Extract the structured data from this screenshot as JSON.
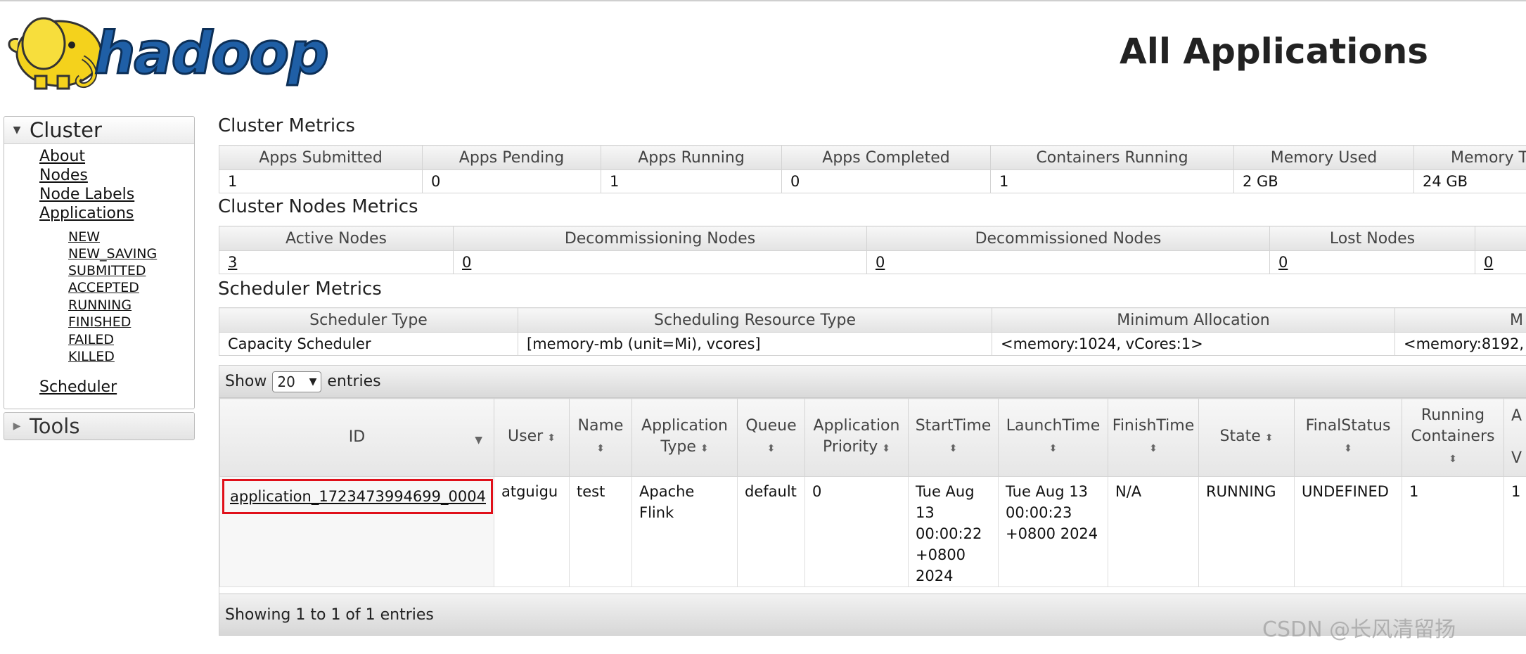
{
  "logo": {
    "text": "hadoop"
  },
  "page_title": "All Applications",
  "sidebar": {
    "cluster_title": "Cluster",
    "cluster_links": [
      "About",
      "Nodes",
      "Node Labels",
      "Applications"
    ],
    "app_states": [
      "NEW",
      "NEW_SAVING",
      "SUBMITTED",
      "ACCEPTED",
      "RUNNING",
      "FINISHED",
      "FAILED",
      "KILLED"
    ],
    "scheduler_link": "Scheduler",
    "tools_title": "Tools"
  },
  "cluster_metrics": {
    "title": "Cluster Metrics",
    "headers": [
      "Apps Submitted",
      "Apps Pending",
      "Apps Running",
      "Apps Completed",
      "Containers Running",
      "Memory Used",
      "Memory T"
    ],
    "values": [
      "1",
      "0",
      "1",
      "0",
      "1",
      "2 GB",
      "24 GB"
    ]
  },
  "nodes_metrics": {
    "title": "Cluster Nodes Metrics",
    "headers": [
      "Active Nodes",
      "Decommissioning Nodes",
      "Decommissioned Nodes",
      "Lost Nodes",
      ""
    ],
    "values": [
      "3",
      "0",
      "0",
      "0",
      "0"
    ]
  },
  "scheduler_metrics": {
    "title": "Scheduler Metrics",
    "headers": [
      "Scheduler Type",
      "Scheduling Resource Type",
      "Minimum Allocation",
      "M"
    ],
    "values": [
      "Capacity Scheduler",
      "[memory-mb (unit=Mi), vcores]",
      "<memory:1024, vCores:1>",
      "<memory:8192,"
    ]
  },
  "apps_table": {
    "show_label": "Show",
    "entries_value": "20",
    "entries_label": "entries",
    "headers": {
      "id": "ID",
      "user": "User",
      "name": "Name",
      "app_type_1": "Application",
      "app_type_2": "Type",
      "queue": "Queue",
      "priority_1": "Application",
      "priority_2": "Priority",
      "start": "StartTime",
      "launch": "LaunchTime",
      "finish": "FinishTime",
      "state": "State",
      "final": "FinalStatus",
      "running_1": "Running",
      "running_2": "Containers",
      "next_1": "A",
      "next_2": "V"
    },
    "row": {
      "id": "application_1723473994699_0004",
      "user": "atguigu",
      "name": "test",
      "app_type_1": "Apache",
      "app_type_2": "Flink",
      "queue": "default",
      "priority": "0",
      "start_1": "Tue Aug",
      "start_2": "13",
      "start_3": "00:00:22",
      "start_4": "+0800",
      "start_5": "2024",
      "launch_1": "Tue Aug 13",
      "launch_2": "00:00:23",
      "launch_3": "+0800 2024",
      "finish": "N/A",
      "state": "RUNNING",
      "final": "UNDEFINED",
      "running": "1",
      "next": "1"
    },
    "footer": "Showing 1 to 1 of 1 entries"
  },
  "watermark": "CSDN @长风清留扬",
  "colors": {
    "highlight": "#e0101a",
    "logo_blue": "#1f5fa6",
    "logo_yellow": "#f4d21c"
  }
}
